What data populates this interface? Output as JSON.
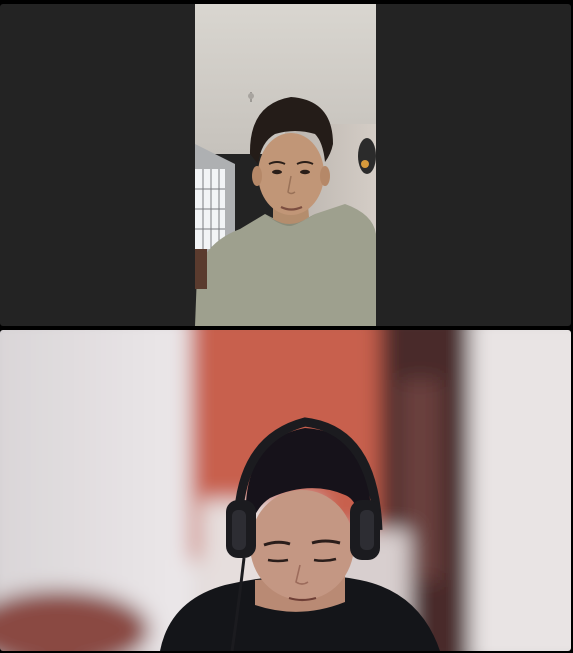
{
  "call": {
    "participants": [
      {
        "tile": "top",
        "background_color": "#232323",
        "video": "camera-feed-portrait"
      },
      {
        "tile": "bottom",
        "background_color": "#232323",
        "video": "camera-feed-wide"
      }
    ]
  }
}
